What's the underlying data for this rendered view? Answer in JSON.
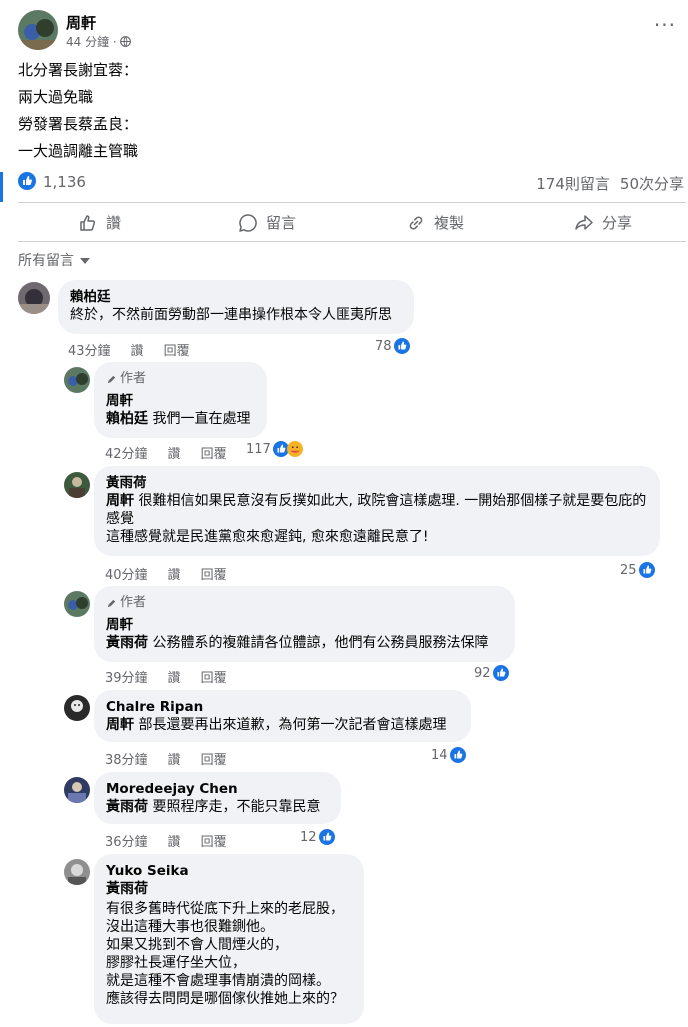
{
  "post": {
    "author": "周軒",
    "time": "44 分鐘 · ",
    "lines": [
      "北分署長謝宜蓉：",
      "兩大過免職",
      "勞發署長蔡孟良：",
      "一大過調離主管職"
    ],
    "like_count": "1,136",
    "comments_count": "174則留言",
    "shares_count": "50次分享"
  },
  "actions": {
    "like": "讚",
    "comment": "留言",
    "copy": "複製",
    "share": "分享"
  },
  "filter_label": "所有留言",
  "labels": {
    "like": "讚",
    "reply": "回覆",
    "author_badge": "作者"
  },
  "comments": [
    {
      "author": "賴柏廷",
      "text": "終於，不然前面勞動部一連串操作根本令人匪夷所思",
      "time": "43分鐘",
      "reactions": "78"
    },
    {
      "author": "周軒",
      "tag": "賴柏廷",
      "text": " 我們一直在處理",
      "time": "42分鐘",
      "reactions": "117"
    },
    {
      "author": "黃雨荷",
      "tag": "周軒",
      "text": " 很難相信如果民意沒有反撲如此大, 政院會這樣處理. 一開始那個樣子就是要包庇的感覺",
      "text2": "這種感覺就是民進黨愈來愈遲鈍, 愈來愈遠離民意了!",
      "time": "40分鐘",
      "reactions": "25"
    },
    {
      "author": "周軒",
      "tag": "黃雨荷",
      "text": " 公務體系的複雜請各位體諒，他們有公務員服務法保障",
      "time": "39分鐘",
      "reactions": "92"
    },
    {
      "author": "Chalre Ripan",
      "tag": "周軒",
      "text": " 部長還要再出來道歉，為何第一次記者會這樣處理",
      "time": "38分鐘",
      "reactions": "14"
    },
    {
      "author": "Moredeejay Chen",
      "tag": "黃雨荷",
      "text": " 要照程序走，不能只靠民意",
      "time": "36分鐘",
      "reactions": "12"
    },
    {
      "author": "Yuko Seika",
      "tag": "黃雨荷",
      "lines": [
        "有很多舊時代從底下升上來的老屁股，",
        "沒出這種大事也很難鍘他。",
        "如果又挑到不會人間煙火的，",
        "膠膠社長運仔坐大位，",
        "就是這種不會處理事情崩潰的岡樣。",
        "應該得去問問是哪個傢伙推她上來的？"
      ]
    }
  ],
  "colors": {
    "accent": "#1b74e4",
    "bubble": "#f0f2f5",
    "muted": "#65676b"
  }
}
